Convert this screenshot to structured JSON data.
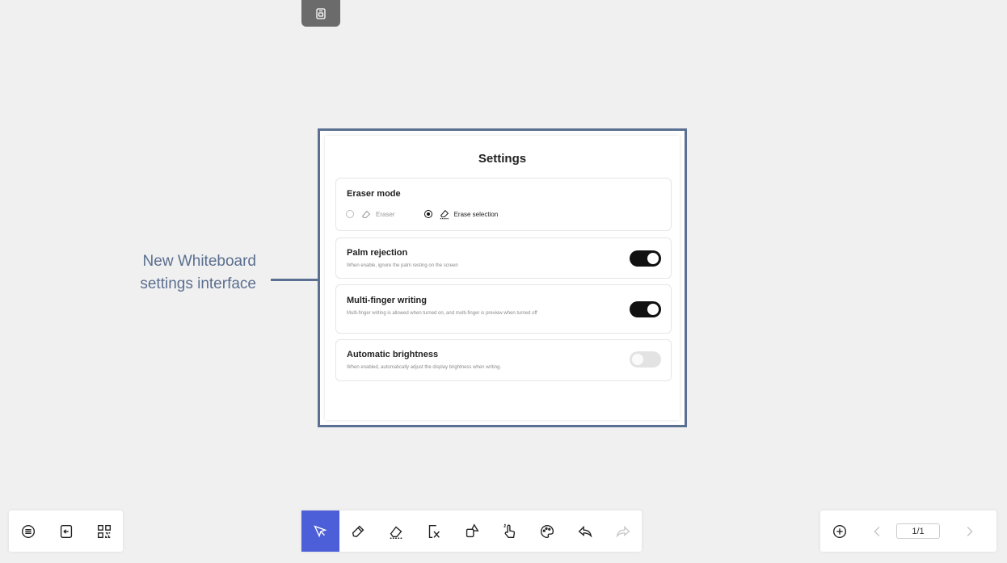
{
  "annotation": {
    "line1": "New Whiteboard",
    "line2": "settings interface"
  },
  "settings": {
    "title": "Settings",
    "eraser_mode": {
      "title": "Eraser mode",
      "options": [
        {
          "label": "Eraser",
          "selected": false
        },
        {
          "label": "Erase selection",
          "selected": true
        }
      ]
    },
    "palm_rejection": {
      "title": "Palm rejection",
      "desc": "When enable, ignore the palm resting on the screen",
      "enabled": true
    },
    "multi_finger": {
      "title": "Multi-finger writing",
      "desc": "Multi-finger writing is allowed when turned on, and multi-finger is preview when turned off",
      "enabled": true
    },
    "auto_brightness": {
      "title": "Automatic brightness",
      "desc": "When enabled, automatically adjust the display brightness when writing.",
      "enabled": false
    }
  },
  "toolbar": {
    "left": [
      "menu-icon",
      "exit-icon",
      "qr-code-icon"
    ],
    "center": [
      "select-icon",
      "pen-icon",
      "eraser-icon",
      "clear-icon",
      "shapes-icon",
      "gesture-icon",
      "palette-icon",
      "undo-icon",
      "redo-icon"
    ],
    "active_tool": "select-icon"
  },
  "pager": {
    "current": "1/1"
  },
  "colors": {
    "accent": "#4d5fd8",
    "callout": "#5a6f91"
  }
}
